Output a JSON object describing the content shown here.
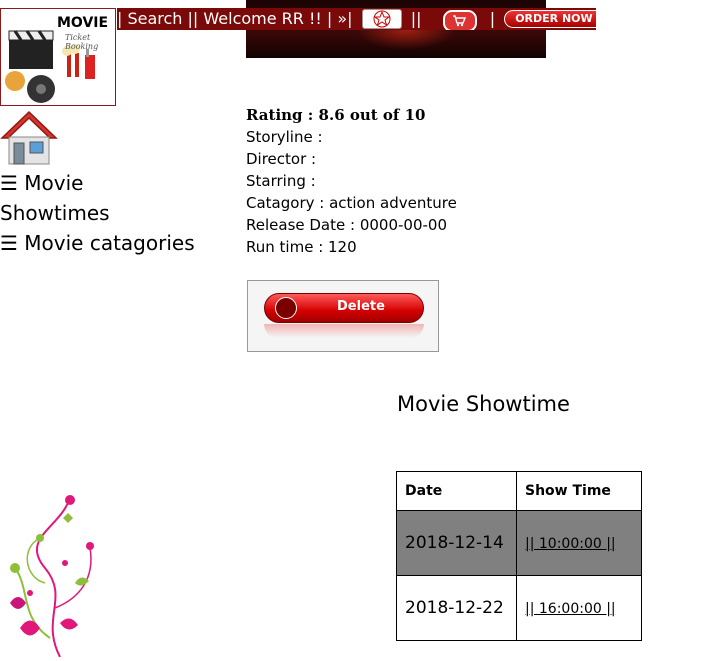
{
  "header": {
    "logo_title": "MOVIE",
    "logo_subtitle": "Ticket Booking",
    "nav_text_1": "| Search || Welcome RR !! | »|",
    "nav_text_2": "||",
    "nav_text_3": "|",
    "order_label": "ORDER NOW",
    "bar_color": "#7a0a0a"
  },
  "sidebar": {
    "items": [
      {
        "label": "☰ Movie"
      },
      {
        "label": "Showtimes"
      },
      {
        "label": "☰ Movie catagories"
      }
    ]
  },
  "movie": {
    "rating": "Rating : 8.6 out of 10",
    "storyline": "Storyline :",
    "director": "Director :",
    "starring": "Starring :",
    "category": "Catagory : action adventure",
    "release": "Release Date : 0000-00-00",
    "runtime": "Run time : 120"
  },
  "delete_button": {
    "label": "Delete"
  },
  "showtime": {
    "title": "Movie Showtime",
    "columns": [
      "Date",
      "Show Time"
    ],
    "rows": [
      {
        "date": "2018-12-14",
        "time": "|| 10:00:00 ||"
      },
      {
        "date": "2018-12-22",
        "time": "|| 16:00:00 ||"
      }
    ]
  }
}
